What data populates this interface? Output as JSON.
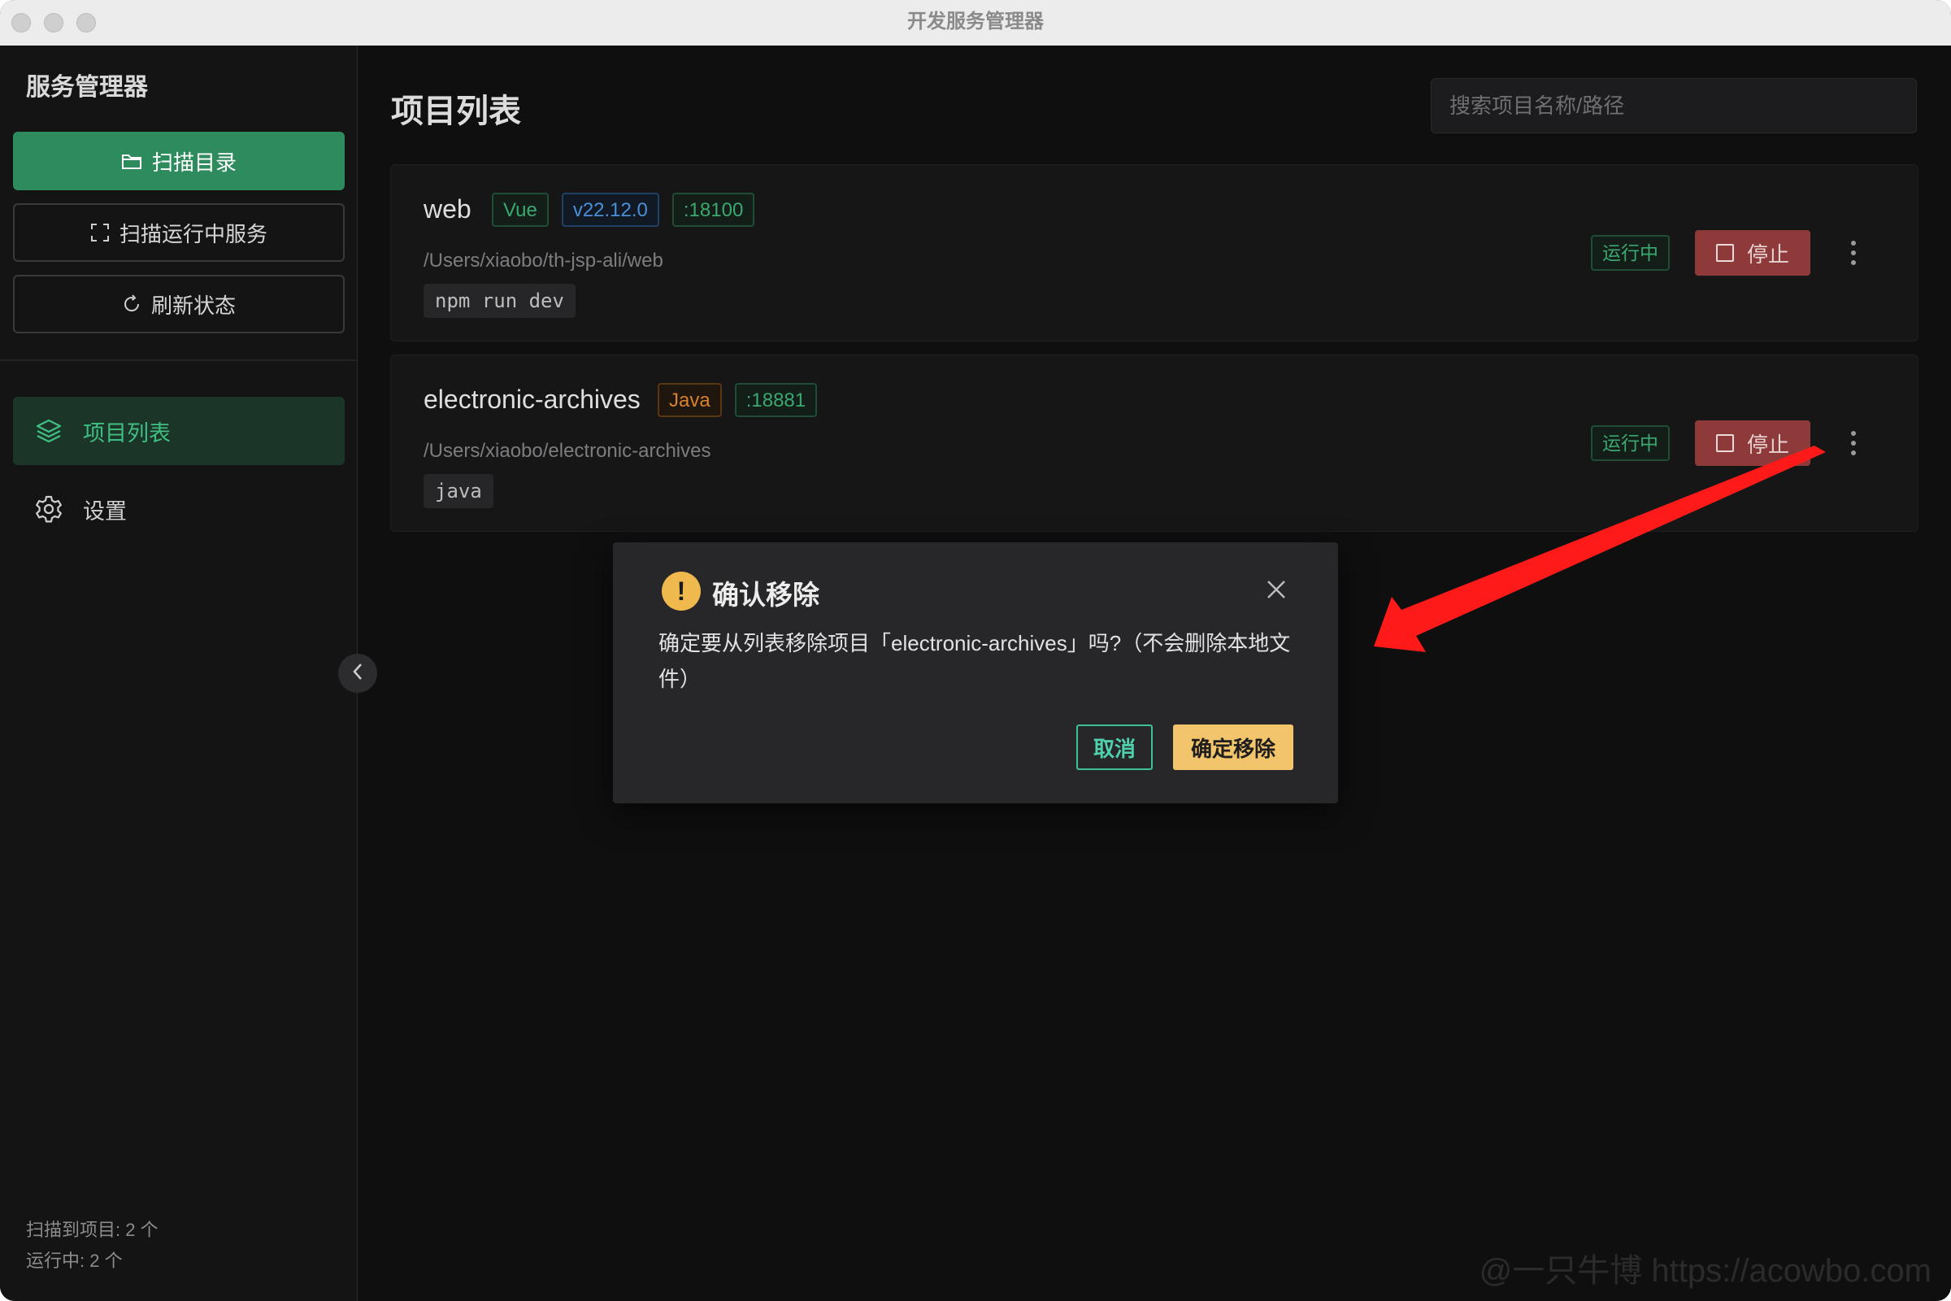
{
  "window": {
    "title": "开发服务管理器"
  },
  "sidebar": {
    "app_name": "服务管理器",
    "buttons": [
      {
        "label": "扫描目录",
        "icon": "folder-icon"
      },
      {
        "label": "扫描运行中服务",
        "icon": "scan-icon"
      },
      {
        "label": "刷新状态",
        "icon": "refresh-icon"
      }
    ],
    "nav": [
      {
        "label": "项目列表",
        "icon": "layers-icon",
        "active": true
      },
      {
        "label": "设置",
        "icon": "gear-icon",
        "active": false
      }
    ],
    "stats": {
      "scanned": "扫描到项目: 2 个",
      "running": "运行中: 2 个"
    }
  },
  "main": {
    "title": "项目列表",
    "search_placeholder": "搜索项目名称/路径",
    "projects": [
      {
        "name": "web",
        "tags": [
          "Vue",
          "v22.12.0",
          ":18100"
        ],
        "path": "/Users/xiaobo/th-jsp-ali/web",
        "command": "npm run dev",
        "status": "运行中",
        "stop_label": "停止"
      },
      {
        "name": "electronic-archives",
        "tags": [
          "Java",
          ":18881"
        ],
        "path": "/Users/xiaobo/electronic-archives",
        "command": "java",
        "status": "运行中",
        "stop_label": "停止"
      }
    ]
  },
  "dialog": {
    "title": "确认移除",
    "message": "确定要从列表移除项目「electronic-archives」吗?（不会删除本地文件）",
    "cancel_label": "取消",
    "confirm_label": "确定移除"
  },
  "watermark": "@一只牛博 https://acowbo.com",
  "colors": {
    "accent_green": "#2e8b5d",
    "stop_red": "#8f3a3a",
    "warning_yellow": "#f0b94d",
    "confirm_button": "#f2c46b",
    "annotation_arrow": "#ff1a1a"
  }
}
